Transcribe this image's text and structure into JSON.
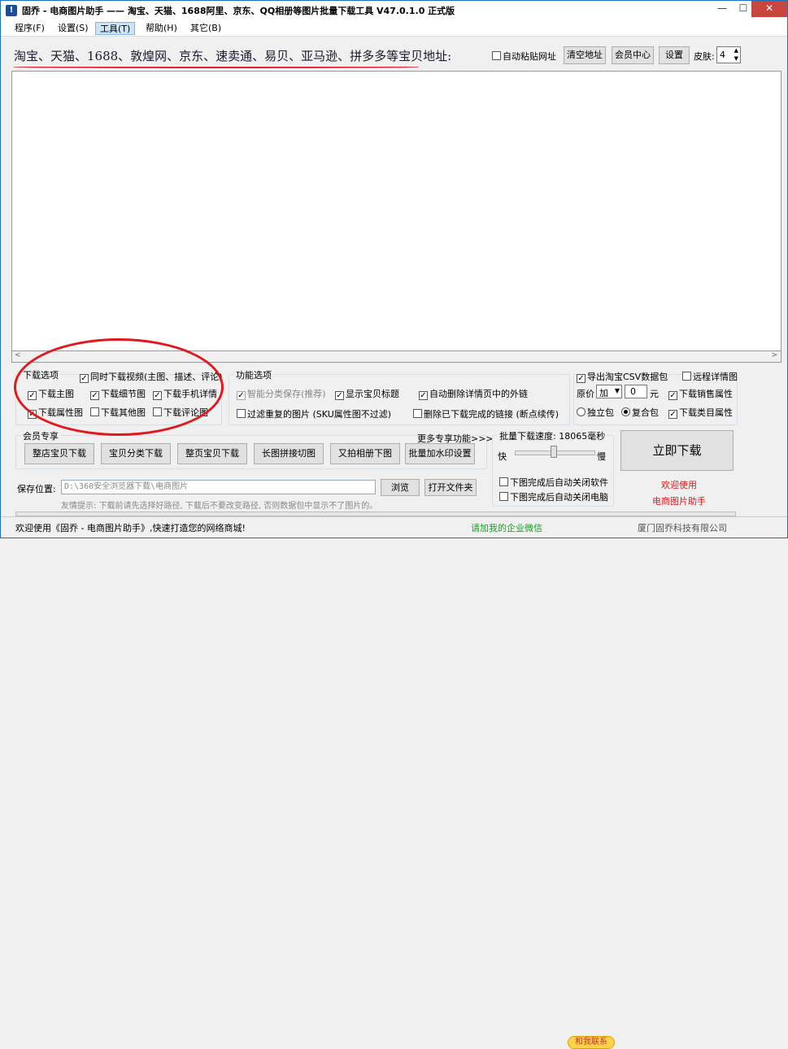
{
  "window": {
    "title": "固乔 - 电商图片助手 —— 淘宝、天猫、1688阿里、京东、QQ相册等图片批量下载工具 V47.0.1.0 正式版",
    "minimize_glyph": "—",
    "maximize_glyph": "☐",
    "close_glyph": "✕"
  },
  "menu": [
    {
      "label": "程序(F)"
    },
    {
      "label": "设置(S)"
    },
    {
      "label": "工具(T)"
    },
    {
      "label": "帮助(H)"
    },
    {
      "label": "其它(B)"
    }
  ],
  "toolbar": {
    "platforms_text": "淘宝、天猫、1688、敦煌网、京东、速卖通、易贝、亚马逊、拼多多等宝贝地址:",
    "auto_paste_label": "自动粘贴网址",
    "clear_btn": "清空地址",
    "member_btn": "会员中心",
    "settings_btn": "设置",
    "skin_label": "皮肤:",
    "skin_value": "4"
  },
  "download_options": {
    "title": "下载选项",
    "video_label": "同时下载视频(主图、描述、评论)",
    "main_img": "下载主图",
    "detail_img": "下载细节图",
    "mobile_detail": "下载手机详情",
    "attr_img": "下载属性图",
    "other_img": "下载其他图",
    "review_img": "下载评论图"
  },
  "feature_options": {
    "title": "功能选项",
    "smart_save": "智能分类保存(推荐)",
    "show_title": "显示宝贝标题",
    "auto_delete_links": "自动删除详情页中的外链",
    "filter_dup": "过滤重复的图片 (SKU属性图不过滤)",
    "delete_done": "删除已下载完成的链接 (断点续传)"
  },
  "export": {
    "csv_label": "导出淘宝CSV数据包",
    "remote_detail": "远程详情图",
    "price_label": "原价",
    "price_op": "加",
    "price_value": "0",
    "price_unit": "元",
    "sales_attr": "下载销售属性",
    "single_pkg": "独立包",
    "combo_pkg": "复合包",
    "category_attr": "下载类目属性"
  },
  "member": {
    "title": "会员专享",
    "more": "更多专享功能>>>",
    "buttons": [
      "整店宝贝下载",
      "宝贝分类下载",
      "整页宝贝下载",
      "长图拼接切图",
      "又拍相册下图",
      "批量加水印设置"
    ]
  },
  "speed": {
    "title": "批量下载速度: 18065毫秒",
    "fast": "快",
    "slow": "慢",
    "close_software": "下图完成后自动关闭软件",
    "shutdown_pc": "下图完成后自动关闭电脑",
    "slider_fraction": 0.45
  },
  "download_now": "立即下载",
  "welcome": {
    "line1": "欢迎使用",
    "line2": "电商图片助手",
    "color": "#e0191f"
  },
  "save": {
    "label": "保存位置:",
    "path": "D:\\360安全浏览器下载\\电商图片",
    "browse": "浏览",
    "open_folder": "打开文件夹",
    "hint": "友情提示: 下载前请先选择好路径, 下载后不要改变路径, 否则数据包中显示不了图片的。"
  },
  "status": {
    "left": "欢迎使用《固乔 - 电商图片助手》,快速打造您的网络商城!",
    "wechat": "请加我的企业微信",
    "contact": "和我联系",
    "company": "厦门固乔科技有限公司",
    "wechat_color": "#1a9a2a"
  }
}
